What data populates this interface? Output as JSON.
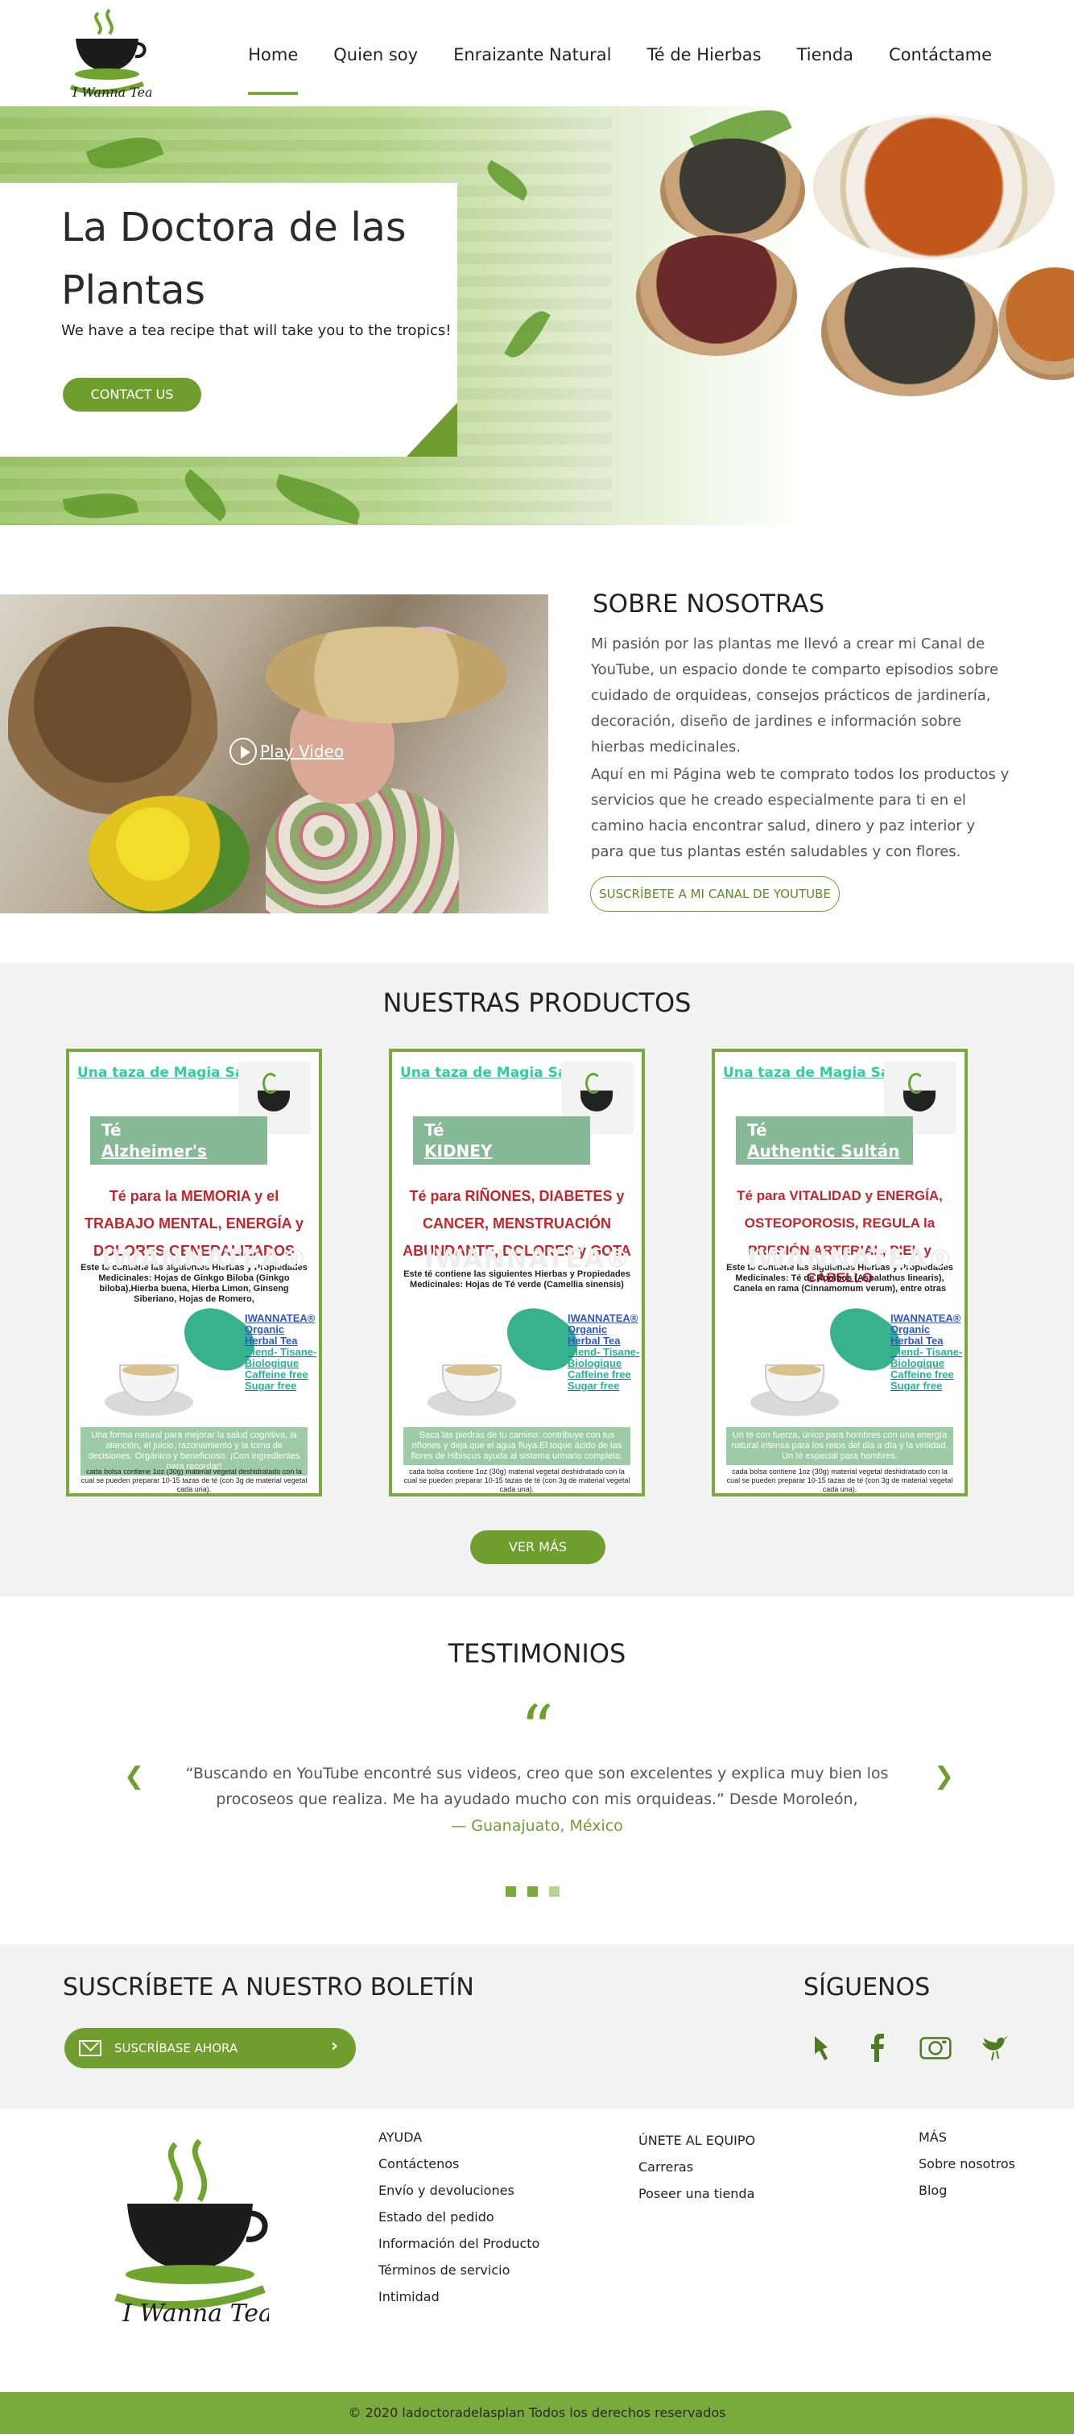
{
  "nav": {
    "links": [
      "Home",
      "Quien soy",
      "Enraizante Natural",
      "Té de Hierbas",
      "Tienda",
      "Contáctame"
    ]
  },
  "logo": {
    "text": "I Wanna Tea"
  },
  "hero": {
    "title": "La Doctora de las Plantas",
    "subtitle": "We have a tea recipe that will take you to the tropics!",
    "button": "CONTACT US"
  },
  "about": {
    "video_label": "Play Video",
    "title": "SOBRE NOSOTRAS",
    "paragraph1": "Mi pasión por las plantas me llevó a crear mi Canal de YouTube, un espacio donde te comparto episodios sobre cuidado de orquideas,  consejos prácticos de jardinería, decoración, diseño de jardines e información sobre hierbas medicinales.",
    "paragraph2": "Aquí en mi Página web te comprato todos los productos y servicios que he creado especialmente para ti en el camino hacia encontrar salud, dinero y paz interior y para que tus plantas estén saludables y con flores.",
    "button": "SUSCRÍBETE A MI CANAL DE YOUTUBE"
  },
  "products": {
    "title": "NUESTRAS PRODUCTOS",
    "button": "VER MÁS",
    "watermark": "IWANNATEA®",
    "items": [
      {
        "header": "Una taza de  Magia Saludable",
        "label": "Té",
        "name": "Alzheimer's enemy",
        "claim": "Té para la MEMORIA y el TRABAJO MENTAL, ENERGÍA  y DOLORES GENERALIZADOS",
        "info": "Este té contiene las siguientes Hierbas y Propiedades Medicinales: Hojas de Ginkgo Biloba (Ginkgo biloba),Hierba buena, Hierba Limon, Ginseng Siberiano, Hojas de Romero,",
        "pack": [
          "IWANNATEA®",
          "Organic Herbal Tea",
          "Blend- Tisane-",
          "Biologique",
          "Caffeine free",
          "Sugar free"
        ],
        "desc": "Una forma natural para mejorar la salud cognitiva, la atención, el juicio, razonamiento y la toma de decisiones. Orgánico y beneficioso. ¡Con ingredientes para recordar!",
        "fine": "cada bolsa contiene 1oz (30g) material vegetal deshidratado con la cual se pueden preparar 10-15 tazas de té (con 3g de material vegetal cada una)."
      },
      {
        "header": "Una taza de  Magia Saludable",
        "label": "Té",
        "name": "KIDNEY CLEANSER",
        "claim": "Té para RIÑONES, DIABETES y CANCER, MENSTRUACIÓN ABUNDANTE, DOLORES y GOTA",
        "info": "Este té contiene las siguientes Hierbas y Propiedades Medicinales: Hojas de Té verde (Camellia sinensis)",
        "pack": [
          "IWANNATEA®",
          "Organic Herbal Tea",
          "Blend- Tisane-",
          "Biologique",
          "Caffeine free",
          "Sugar free"
        ],
        "desc": "Saca las piedras de tu camino: contribuye con tus riñones y deja que el agua fluya.El toque ácido de las flores de Hibiscus ayuda al sistema urinario completo.",
        "fine": "cada bolsa contiene 1oz (30g) material vegetal deshidratado con la cual se pueden preparar 10-15 tazas de té (con 3g de material vegetal cada una)."
      },
      {
        "header": "Una taza de  Magia Saludable",
        "label": "Té",
        "name": "Authentic Sultán",
        "claim": "Té para VITALIDAD y ENERGÍA, OSTEOPOROSIS, REGULA la PRESIÓN ARTERIAL, PIEL y CABELLO",
        "info": "Este té contiene las siguientes Hierbas y Propiedades Medicinales: Té de Rooibos (Aspalathus linearis), Canela en rama (Cinnamomum verum), entre otras",
        "pack": [
          "IWANNATEA®",
          "Organic Herbal Tea",
          "Blend- Tisane-",
          "Biologique",
          "Caffeine free",
          "Sugar free"
        ],
        "desc": "Un té con fuerza, único para hombres con una energía natural intensa para los retos del día a día y la virilidad. Un té especial para hombres.",
        "fine": "cada bolsa contiene 1oz (30g) material vegetal deshidratado con la cual se pueden preparar 10-15 tazas de té (con 3g de material vegetal cada una)."
      }
    ]
  },
  "testimonials": {
    "title": "TESTIMONIOS",
    "quote_mark": "“",
    "text": "“Buscando en YouTube encontré sus videos, creo que son excelentes y explica muy bien los procoseos que realiza. Me ha ayudado mucho con mis orquideas.” Desde Moroleón,",
    "author": "— Guanajuato, México",
    "prev": "❮",
    "next": "❯",
    "active_slide": 1,
    "total_slides": 3
  },
  "newsletter": {
    "title": "SUSCRÍBETE A NUESTRO BOLETÍN",
    "button": "SUSCRÍBASE AHORA",
    "chevron": "›",
    "follow_title": "SÍGUENOS",
    "social_icons": [
      "pin-icon",
      "facebook-icon",
      "instagram-icon",
      "twitter-icon"
    ]
  },
  "footer": {
    "columns": [
      {
        "title": "AYUDA",
        "links": [
          "Contáctenos",
          "Envío y devoluciones",
          "Estado del pedido",
          "Información del Producto",
          "Términos de servicio",
          "Intimidad"
        ]
      },
      {
        "title": "ÚNETE AL EQUIPO",
        "links": [
          "Carreras",
          "Poseer una tienda"
        ]
      },
      {
        "title": "MÁS",
        "links": [
          "Sobre nosotros",
          "Blog"
        ]
      }
    ],
    "copyright": "© 2020 ladoctoradelasplan Todos los derechos reservados"
  },
  "colors": {
    "accent": "#6f9e2f",
    "light_accent": "#7aa93c",
    "section_bg": "#f2f2f2",
    "product_red": "#c0262c",
    "product_teal": "#2fcf9c"
  }
}
